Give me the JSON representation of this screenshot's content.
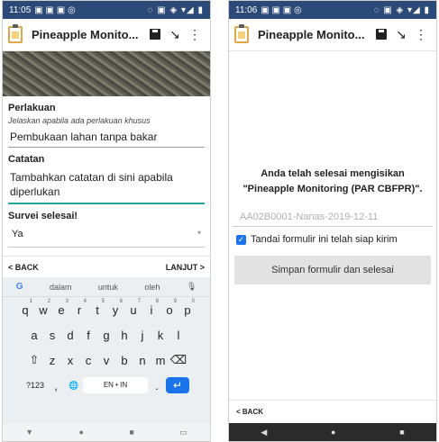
{
  "left": {
    "status": {
      "time": "11:05",
      "left_icons": "▣ ▣ ▣ ◎",
      "right_icons": "◌ ▣ ◈ ▾◢ ▮"
    },
    "appbar": {
      "title": "Pineapple Monito...",
      "save_icon": "save-icon",
      "menu_icon": "⋮"
    },
    "fields": {
      "perlakuan_label": "Perlakuan",
      "perlakuan_hint": "Jelaskan apabila ada perlakuan khusus",
      "perlakuan_value": "Pembukaan lahan tanpa bakar",
      "catatan_label": "Catatan",
      "catatan_value": "Tambahkan catatan di sini apabila diperlukan",
      "survei_label": "Survei selesai!",
      "survei_value": "Ya"
    },
    "nav": {
      "back": "< BACK",
      "next": "LANJUT >"
    },
    "keyboard": {
      "suggestions": [
        "dalam",
        "untuk",
        "oleh"
      ],
      "row1": [
        "q",
        "w",
        "e",
        "r",
        "t",
        "y",
        "u",
        "i",
        "o",
        "p"
      ],
      "row1_nums": [
        "1",
        "2",
        "3",
        "4",
        "5",
        "6",
        "7",
        "8",
        "9",
        "0"
      ],
      "row2": [
        "a",
        "s",
        "d",
        "f",
        "g",
        "h",
        "j",
        "k",
        "l"
      ],
      "row3": [
        "z",
        "x",
        "c",
        "v",
        "b",
        "n",
        "m"
      ],
      "bottom": {
        "symbols": "?123",
        "comma": ",",
        "space": "EN • IN",
        "period": "."
      }
    }
  },
  "right": {
    "status": {
      "time": "11:06",
      "left_icons": "▣ ▣ ▣ ◎",
      "right_icons": "◌ ▣ ◈ ▾◢ ▮"
    },
    "appbar": {
      "title": "Pineapple Monito...",
      "menu_icon": "⋮"
    },
    "done_line1": "Anda telah selesai mengisikan",
    "done_line2": "\"Pineapple Monitoring (PAR CBFPR)\".",
    "instance_name": "AA02B0001-Nanas-2019-12-11",
    "checkbox_label": "Tandai formulir ini telah siap kirim",
    "finish_button": "Simpan formulir dan selesai",
    "back": "< BACK"
  },
  "colors": {
    "statusbar": "#2c4a78",
    "accent": "#26a69a",
    "enter": "#1a73e8"
  }
}
